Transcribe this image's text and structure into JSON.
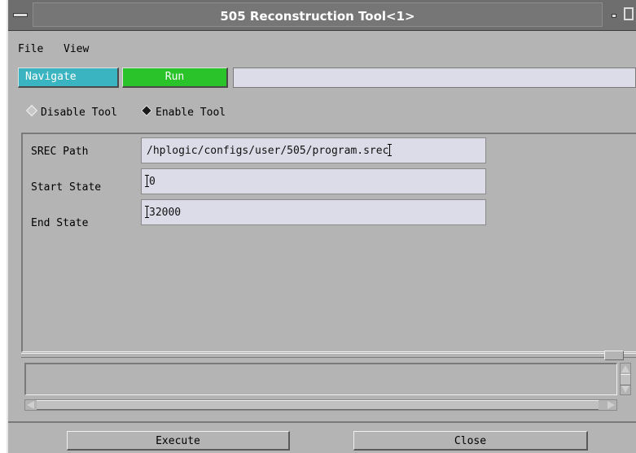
{
  "window": {
    "title": "505 Reconstruction Tool<1>"
  },
  "menubar": {
    "items": [
      "File",
      "View"
    ]
  },
  "toolbar": {
    "navigate_label": "Navigate",
    "run_label": "Run",
    "status_text": ""
  },
  "tool_mode": {
    "options": [
      "Disable Tool",
      "Enable Tool"
    ],
    "selected": "Enable Tool"
  },
  "form": {
    "srec_path": {
      "label": "SREC Path",
      "value": "/hplogic/configs/user/505/program.srec"
    },
    "start_state": {
      "label": "Start State",
      "value": "0"
    },
    "end_state": {
      "label": "End State",
      "value": "32000"
    }
  },
  "message": {
    "text": ""
  },
  "actions": {
    "execute_label": "Execute",
    "close_label": "Close"
  },
  "colors": {
    "navigate": "#3bb4c1",
    "run": "#2ac32a",
    "background": "#b4b4b4",
    "field": "#dcdce8"
  },
  "icons": [
    "window-menu-icon",
    "minimize-icon",
    "maximize-icon",
    "radio-diamond-icon",
    "scroll-arrow-icon"
  ]
}
